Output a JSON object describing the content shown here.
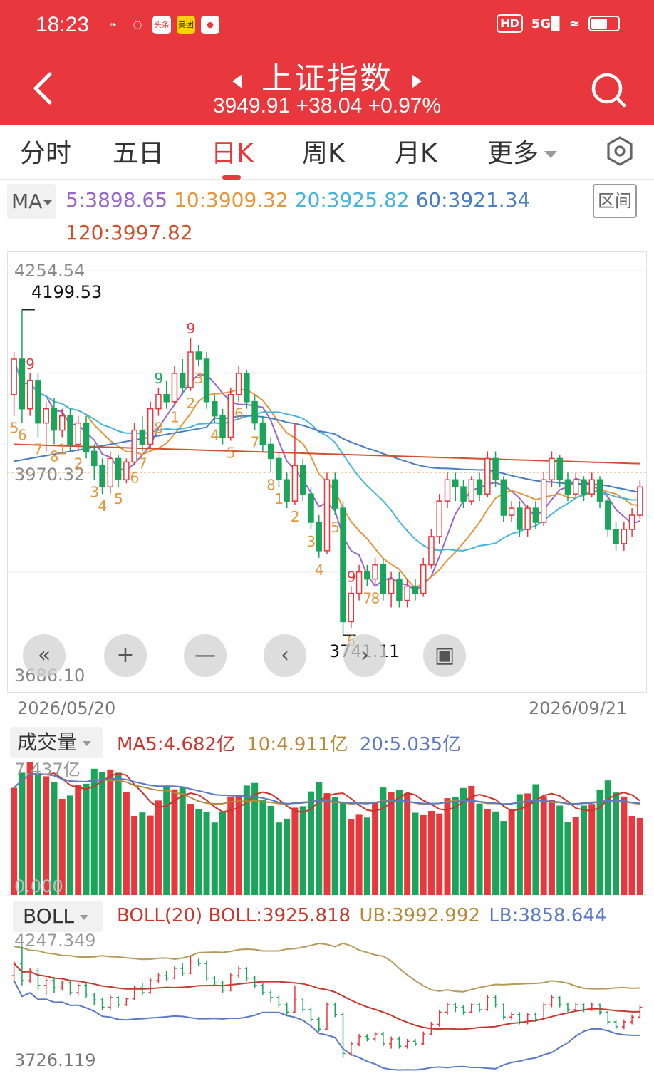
{
  "status": {
    "time": "18:23",
    "network": "5G",
    "hd": "HD",
    "apps": [
      "wechat-icon",
      "weibo-icon",
      "toutiao-icon",
      "meituan-icon",
      "netease-icon"
    ],
    "app_labels": [
      "",
      "",
      "头条",
      "美团",
      ""
    ]
  },
  "header": {
    "title": "上证指数",
    "price": "3949.91",
    "change": "+38.04",
    "change_pct": "+0.97%"
  },
  "tabs": [
    {
      "label": "分时"
    },
    {
      "label": "五日"
    },
    {
      "label": "日K"
    },
    {
      "label": "周K"
    },
    {
      "label": "月K"
    },
    {
      "label": "更多"
    }
  ],
  "ma": {
    "button": "MA",
    "ma5": "5:3898.65",
    "ma10": "10:3909.32",
    "ma20": "20:3925.82",
    "ma60": "60:3921.34",
    "ma120": "120:3997.82",
    "range_button": "区间"
  },
  "kchart": {
    "axis_top": "4254.54",
    "axis_mid": "3970.32",
    "axis_bottom": "3686.10",
    "high_label": "4199.53",
    "low_label": "3741.11",
    "date_start": "2026/05/20",
    "date_end": "2026/09/21"
  },
  "volume": {
    "button": "成交量",
    "ma5": "MA5:4.682亿",
    "ma10": "10:4.911亿",
    "ma20": "20:5.035亿",
    "axis_top": "7.437亿",
    "axis_bottom": "0.000"
  },
  "boll": {
    "button": "BOLL",
    "label": "BOLL(20)",
    "mid": "BOLL:3925.818",
    "ub": "UB:3992.992",
    "lb": "LB:3858.644",
    "axis_top": "4247.349",
    "axis_bottom": "3726.119"
  },
  "colors": {
    "brand": "#e8383d",
    "up": "#e8383d",
    "down": "#1aa55a",
    "ma5": "#9966cc",
    "ma10": "#e4963c",
    "ma20": "#46b4dc",
    "ma60": "#4a7cc2",
    "ma120": "#d2502d",
    "boll_ub": "#b59a5a",
    "boll_mid": "#c8372d",
    "boll_lb": "#5a78c4"
  },
  "chart_data": {
    "type": "candlestick",
    "x_range": [
      "2026/05/20",
      "2026/09/21"
    ],
    "ylim": [
      3686.1,
      4254.54
    ],
    "marked_high": 4199.53,
    "marked_low": 3741.11,
    "current_price_line": 3970.32,
    "candles": [
      [
        4080,
        4130,
        4050,
        4140
      ],
      [
        4130,
        4060,
        4040,
        4199.53
      ],
      [
        4060,
        4100,
        4050,
        4110
      ],
      [
        4100,
        4040,
        4020,
        4110
      ],
      [
        4040,
        4060,
        4000,
        4070
      ],
      [
        4060,
        4030,
        4010,
        4075
      ],
      [
        4030,
        4050,
        4020,
        4060
      ],
      [
        4050,
        4010,
        4000,
        4060
      ],
      [
        4010,
        4040,
        4000,
        4050
      ],
      [
        4040,
        4000,
        3990,
        4050
      ],
      [
        4000,
        3980,
        3960,
        4010
      ],
      [
        3980,
        3950,
        3940,
        3990
      ],
      [
        3950,
        3990,
        3940,
        4000
      ],
      [
        3990,
        3960,
        3950,
        3995
      ],
      [
        3960,
        3985,
        3955,
        3990
      ],
      [
        3985,
        4030,
        3980,
        4040
      ],
      [
        4030,
        4010,
        4000,
        4050
      ],
      [
        4010,
        4060,
        4005,
        4070
      ],
      [
        4060,
        4080,
        4050,
        4090
      ],
      [
        4080,
        4070,
        4060,
        4100
      ],
      [
        4070,
        4110,
        4065,
        4120
      ],
      [
        4110,
        4090,
        4080,
        4130
      ],
      [
        4090,
        4140,
        4085,
        4160
      ],
      [
        4140,
        4130,
        4120,
        4150
      ],
      [
        4130,
        4070,
        4060,
        4140
      ],
      [
        4070,
        4050,
        4040,
        4080
      ],
      [
        4050,
        4020,
        4010,
        4060
      ],
      [
        4020,
        4080,
        4015,
        4090
      ],
      [
        4080,
        4110,
        4070,
        4120
      ],
      [
        4110,
        4070,
        4060,
        4115
      ],
      [
        4070,
        4040,
        4030,
        4080
      ],
      [
        4040,
        4010,
        4000,
        4050
      ],
      [
        4010,
        3990,
        3970,
        4020
      ],
      [
        3990,
        3960,
        3950,
        4000
      ],
      [
        3960,
        3930,
        3920,
        3970
      ],
      [
        3930,
        3980,
        3925,
        4040
      ],
      [
        3980,
        3940,
        3930,
        3990
      ],
      [
        3940,
        3900,
        3890,
        3950
      ],
      [
        3900,
        3860,
        3850,
        3910
      ],
      [
        3860,
        3960,
        3855,
        3970
      ],
      [
        3960,
        3920,
        3910,
        3970
      ],
      [
        3920,
        3760,
        3741.11,
        3930
      ],
      [
        3760,
        3800,
        3750,
        3810
      ],
      [
        3800,
        3830,
        3790,
        3840
      ],
      [
        3830,
        3820,
        3810,
        3840
      ],
      [
        3820,
        3840,
        3810,
        3850
      ],
      [
        3840,
        3800,
        3790,
        3850
      ],
      [
        3800,
        3820,
        3780,
        3830
      ],
      [
        3820,
        3790,
        3780,
        3830
      ],
      [
        3790,
        3810,
        3780,
        3820
      ],
      [
        3810,
        3800,
        3790,
        3820
      ],
      [
        3800,
        3840,
        3795,
        3850
      ],
      [
        3840,
        3880,
        3835,
        3890
      ],
      [
        3880,
        3930,
        3870,
        3940
      ],
      [
        3930,
        3960,
        3920,
        3970
      ],
      [
        3960,
        3950,
        3930,
        3970
      ],
      [
        3950,
        3930,
        3920,
        3960
      ],
      [
        3930,
        3960,
        3925,
        3965
      ],
      [
        3960,
        3940,
        3930,
        3970
      ],
      [
        3940,
        3990,
        3935,
        4000
      ],
      [
        3990,
        3960,
        3950,
        4000
      ],
      [
        3960,
        3910,
        3900,
        3965
      ],
      [
        3910,
        3920,
        3900,
        3930
      ],
      [
        3920,
        3890,
        3880,
        3930
      ],
      [
        3890,
        3920,
        3880,
        3925
      ],
      [
        3920,
        3900,
        3890,
        3930
      ],
      [
        3900,
        3960,
        3895,
        3970
      ],
      [
        3960,
        3990,
        3950,
        4000
      ],
      [
        3990,
        3960,
        3950,
        3995
      ],
      [
        3960,
        3940,
        3930,
        3970
      ],
      [
        3940,
        3960,
        3935,
        3970
      ],
      [
        3960,
        3940,
        3930,
        3965
      ],
      [
        3940,
        3960,
        3935,
        3970
      ],
      [
        3960,
        3930,
        3920,
        3965
      ],
      [
        3930,
        3890,
        3880,
        3935
      ],
      [
        3890,
        3870,
        3860,
        3900
      ],
      [
        3870,
        3890,
        3860,
        3900
      ],
      [
        3890,
        3910,
        3880,
        3920
      ],
      [
        3910,
        3949.91,
        3905,
        3960
      ]
    ],
    "seq_numbers_orange": [
      "5",
      "6",
      "7",
      "8",
      "1",
      "2",
      "3",
      "4",
      "5",
      "6",
      "7",
      "8",
      "1",
      "2",
      "3",
      "4",
      "5",
      "6",
      "7",
      "8",
      "1",
      "2",
      "3",
      "4",
      "5",
      "6",
      "7",
      "8"
    ],
    "seq_numbers_red": [
      "9",
      "9",
      "9"
    ],
    "seq_numbers_green": [
      "9"
    ]
  }
}
